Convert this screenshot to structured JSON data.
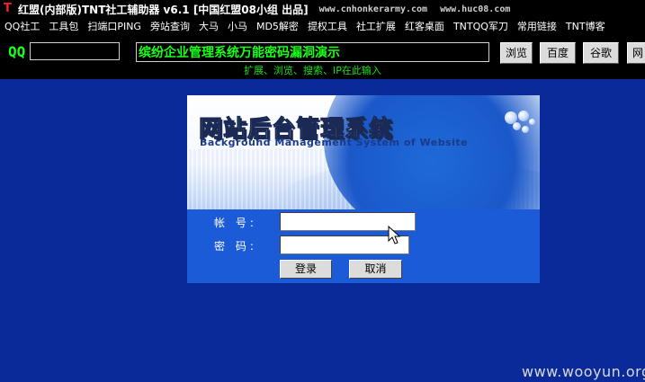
{
  "window": {
    "title": "红盟(内部版)TNT社工辅助器 v6.1 [中国红盟08小组 出品]",
    "url1": "www.cnhonkerarmy.com",
    "url2": "www.huc08.com"
  },
  "menu": [
    "QQ社工",
    "工具包",
    "扫端口PING",
    "旁站查询",
    "大马",
    "小马",
    "MD5解密",
    "提权工具",
    "社工扩展",
    "红客桌面",
    "TNTQQ军刀",
    "常用链接",
    "TNT博客"
  ],
  "toolbar": {
    "qq_label": "QQ",
    "qq_value": "",
    "url_value": "缤纷企业管理系统万能密码漏洞演示",
    "hint": "扩展、浏览、搜索、IP在此输入",
    "buttons": [
      "浏览",
      "百度",
      "谷歌",
      "网"
    ]
  },
  "login": {
    "banner_title": "网站后台管理系统",
    "banner_subtitle": "Background Management System of Website",
    "username_label": "帐 号:",
    "password_label": "密 码:",
    "username_value": "",
    "password_value": "",
    "submit_label": "登录",
    "cancel_label": "取消"
  },
  "watermark": "www.wooyun.org",
  "colors": {
    "background": "#0a2a9a",
    "panel": "#1c5bd8",
    "accent_text": "#19ff19",
    "title_icon": "#ff2020"
  }
}
